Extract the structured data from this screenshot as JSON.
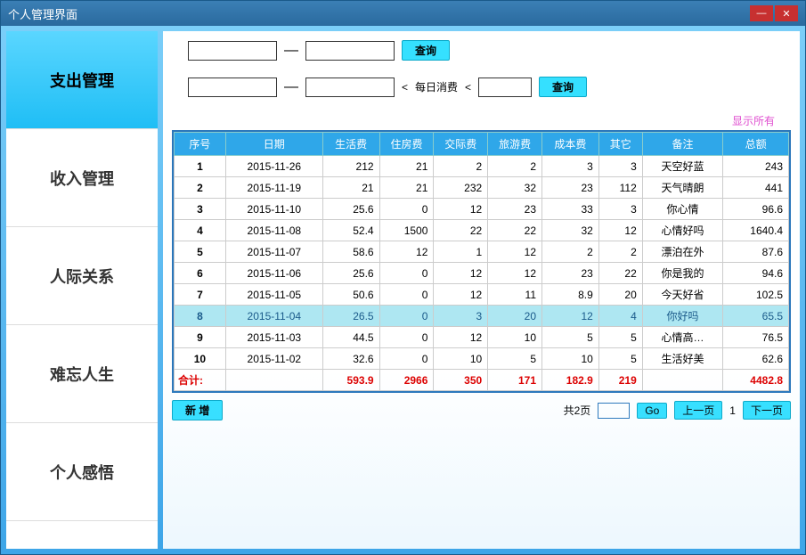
{
  "title": "个人管理界面",
  "sidebar": {
    "items": [
      {
        "label": "支出管理",
        "active": true
      },
      {
        "label": "收入管理",
        "active": false
      },
      {
        "label": "人际关系",
        "active": false
      },
      {
        "label": "难忘人生",
        "active": false
      },
      {
        "label": "个人感悟",
        "active": false
      }
    ]
  },
  "search1": {
    "query_label": "查询"
  },
  "search2": {
    "daily_label": "每日消费",
    "query_label": "查询"
  },
  "show_all": "显示所有",
  "columns": [
    "序号",
    "日期",
    "生活费",
    "住房费",
    "交际费",
    "旅游费",
    "成本费",
    "其它",
    "备注",
    "总额"
  ],
  "rows": [
    {
      "seq": "1",
      "date": "2015-11-26",
      "life": "212",
      "house": "21",
      "social": "2",
      "travel": "2",
      "cost": "3",
      "other": "3",
      "remark": "天空好蓝",
      "total": "243"
    },
    {
      "seq": "2",
      "date": "2015-11-19",
      "life": "21",
      "house": "21",
      "social": "232",
      "travel": "32",
      "cost": "23",
      "other": "112",
      "remark": "天气晴朗",
      "total": "441"
    },
    {
      "seq": "3",
      "date": "2015-11-10",
      "life": "25.6",
      "house": "0",
      "social": "12",
      "travel": "23",
      "cost": "33",
      "other": "3",
      "remark": "你心情",
      "total": "96.6"
    },
    {
      "seq": "4",
      "date": "2015-11-08",
      "life": "52.4",
      "house": "1500",
      "social": "22",
      "travel": "22",
      "cost": "32",
      "other": "12",
      "remark": "心情好吗",
      "total": "1640.4"
    },
    {
      "seq": "5",
      "date": "2015-11-07",
      "life": "58.6",
      "house": "12",
      "social": "1",
      "travel": "12",
      "cost": "2",
      "other": "2",
      "remark": "漂泊在外",
      "total": "87.6"
    },
    {
      "seq": "6",
      "date": "2015-11-06",
      "life": "25.6",
      "house": "0",
      "social": "12",
      "travel": "12",
      "cost": "23",
      "other": "22",
      "remark": "你是我的",
      "total": "94.6"
    },
    {
      "seq": "7",
      "date": "2015-11-05",
      "life": "50.6",
      "house": "0",
      "social": "12",
      "travel": "11",
      "cost": "8.9",
      "other": "20",
      "remark": "今天好省",
      "total": "102.5"
    },
    {
      "seq": "8",
      "date": "2015-11-04",
      "life": "26.5",
      "house": "0",
      "social": "3",
      "travel": "20",
      "cost": "12",
      "other": "4",
      "remark": "你好吗",
      "total": "65.5",
      "selected": true
    },
    {
      "seq": "9",
      "date": "2015-11-03",
      "life": "44.5",
      "house": "0",
      "social": "12",
      "travel": "10",
      "cost": "5",
      "other": "5",
      "remark": "心情高…",
      "total": "76.5"
    },
    {
      "seq": "10",
      "date": "2015-11-02",
      "life": "32.6",
      "house": "0",
      "social": "10",
      "travel": "5",
      "cost": "10",
      "other": "5",
      "remark": "生活好美",
      "total": "62.6"
    }
  ],
  "totals": {
    "label": "合计:",
    "life": "593.9",
    "house": "2966",
    "social": "350",
    "travel": "171",
    "cost": "182.9",
    "other": "219",
    "total": "4482.8"
  },
  "footer": {
    "add": "新 增",
    "pages": "共2页",
    "go": "Go",
    "prev": "上一页",
    "next": "下一页",
    "current": "1"
  }
}
